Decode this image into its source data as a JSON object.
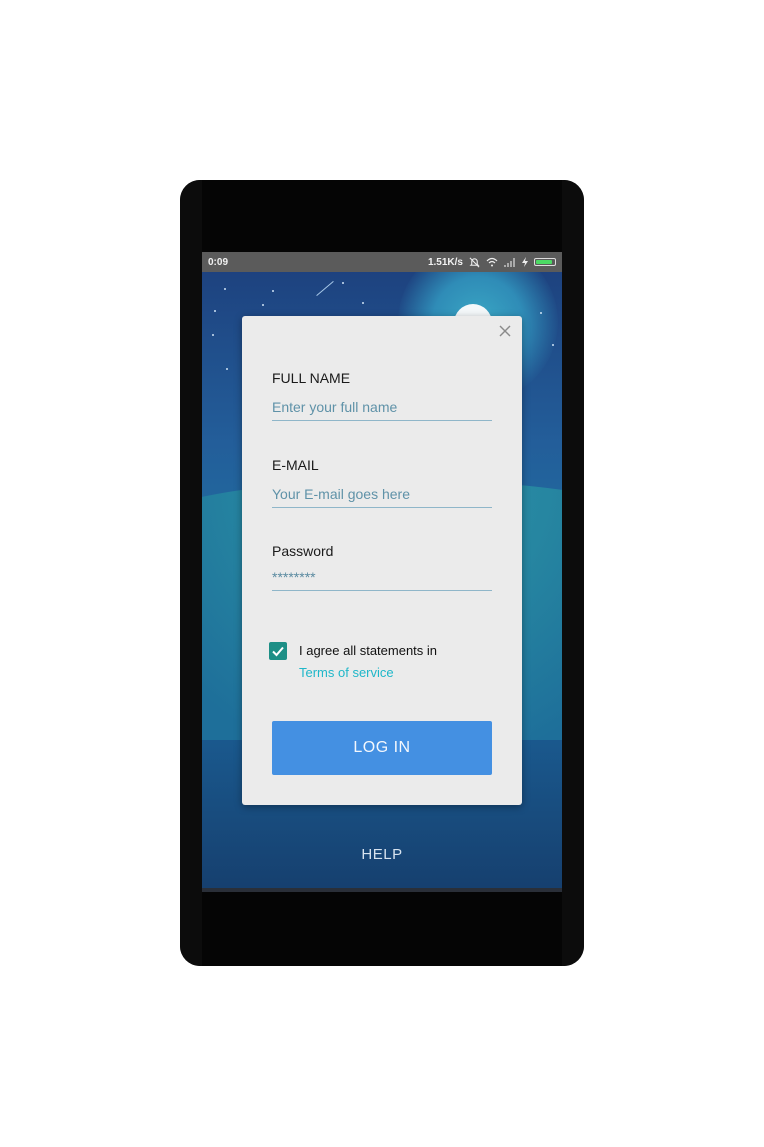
{
  "status_bar": {
    "time": "0:09",
    "network_speed": "1.51K/s",
    "icons": [
      "mute-icon",
      "wifi-icon",
      "signal-icon",
      "charging-icon",
      "battery-icon"
    ],
    "battery_level": 0.9
  },
  "form": {
    "full_name_label": "FULL NAME",
    "full_name_placeholder": "Enter your full name",
    "email_label": "E-MAIL",
    "email_placeholder": "Your E-mail goes here",
    "password_label": "Password",
    "password_value": "********",
    "agree_text": "I agree all statements in",
    "terms_link": "Terms of service",
    "agree_checked": true,
    "login_label": "LOG IN",
    "close_icon": "close-icon"
  },
  "footer": {
    "help_label": "HELP"
  },
  "colors": {
    "button": "#4490e2",
    "checkbox": "#1d8f86",
    "link": "#1fb7c9",
    "dialog": "#ebebeb"
  }
}
